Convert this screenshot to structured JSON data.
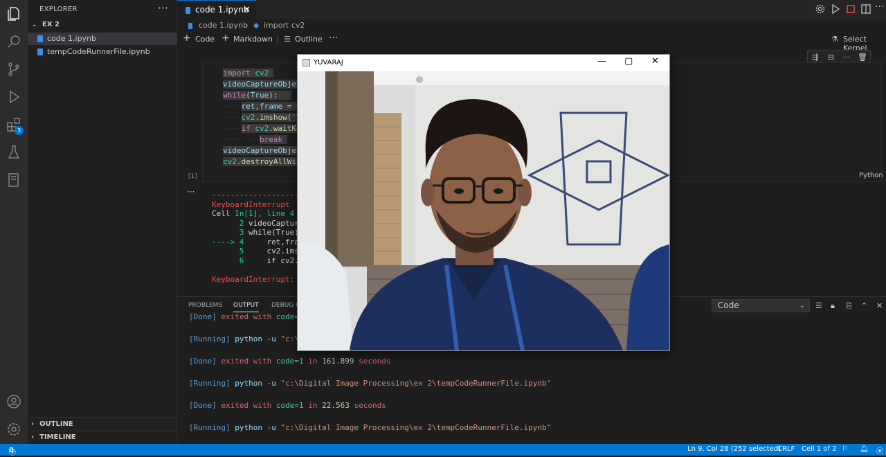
{
  "activity_bar": {
    "badge": "3",
    "icons": [
      "files-icon",
      "search-icon",
      "source-control-icon",
      "run-debug-icon",
      "extensions-icon",
      "testing-icon",
      "notebook-icon",
      "account-icon",
      "settings-gear-icon"
    ]
  },
  "sidebar": {
    "title": "EXPLORER",
    "folder": "EX 2",
    "files": [
      {
        "label": "code 1.ipynb"
      },
      {
        "label": "tempCodeRunnerFile.ipynb"
      }
    ],
    "sections": [
      "OUTLINE",
      "TIMELINE"
    ]
  },
  "editor": {
    "tab": "code 1.ipynb",
    "breadcrumb": [
      "code 1.ipynb",
      "import cv2"
    ],
    "toolbar": {
      "code": "Code",
      "markdown": "Markdown",
      "outline": "Outline",
      "kernel": "Select Kernel"
    },
    "cell": {
      "count": "[1]",
      "language": "Python"
    }
  },
  "output_trace": {
    "dashes": "----------------------------------------------------------------------",
    "error": "KeyboardInterrupt",
    "cell_prefix": "Cell ",
    "cell_ref": "In[1], line 4",
    "lines": [
      {
        "arrow": "",
        "num": "2",
        "code": "videoCaptur"
      },
      {
        "arrow": "",
        "num": "3",
        "code": "while(True)"
      },
      {
        "arrow": "----> ",
        "num": "4",
        "code": "    ret,fra"
      },
      {
        "arrow": "",
        "num": "5",
        "code": "    cv2.ims"
      },
      {
        "arrow": "",
        "num": "6",
        "code": "    if cv2."
      }
    ],
    "final": "KeyboardInterrupt:"
  },
  "panel": {
    "tabs": [
      "PROBLEMS",
      "OUTPUT",
      "DEBUG C"
    ],
    "active_tab": "OUTPUT",
    "channel": "Code",
    "lines": [
      {
        "tag": "[Done]",
        "text": " exited with ",
        "code": "code=1",
        "rest": ""
      },
      {
        "tag": "[Running]",
        "text": " python -u ",
        "path": "\"c:\\",
        "rest": ""
      },
      {
        "tag": "[Done]",
        "text": " exited with ",
        "code": "code=1",
        "in": " in ",
        "num": "161.899",
        "sec": " seconds"
      },
      {
        "tag": "[Running]",
        "text": " python -u ",
        "path": "\"c:\\Digital Image Processing\\ex 2\\tempCodeRunnerFile.ipynb\""
      },
      {
        "tag": "[Done]",
        "text": " exited with ",
        "code": "code=1",
        "in": " in ",
        "num": "22.563",
        "sec": " seconds"
      },
      {
        "tag": "[Running]",
        "text": " python -u ",
        "path": "\"c:\\Digital Image Processing\\ex 2\\tempCodeRunnerFile.ipynb\""
      }
    ]
  },
  "statusbar": {
    "errors": "0",
    "warnings": "0",
    "position": "Ln 9, Col 28 (252 selected)",
    "eol": "CRLF",
    "cell": "Cell 1 of 2"
  },
  "camera_window": {
    "title": "YUVARAJ"
  },
  "colors": {
    "accent": "#0078d4",
    "editor_bg": "#1e1e1e",
    "sidebar_bg": "#202020",
    "activity_bg": "#2c2c2c"
  }
}
